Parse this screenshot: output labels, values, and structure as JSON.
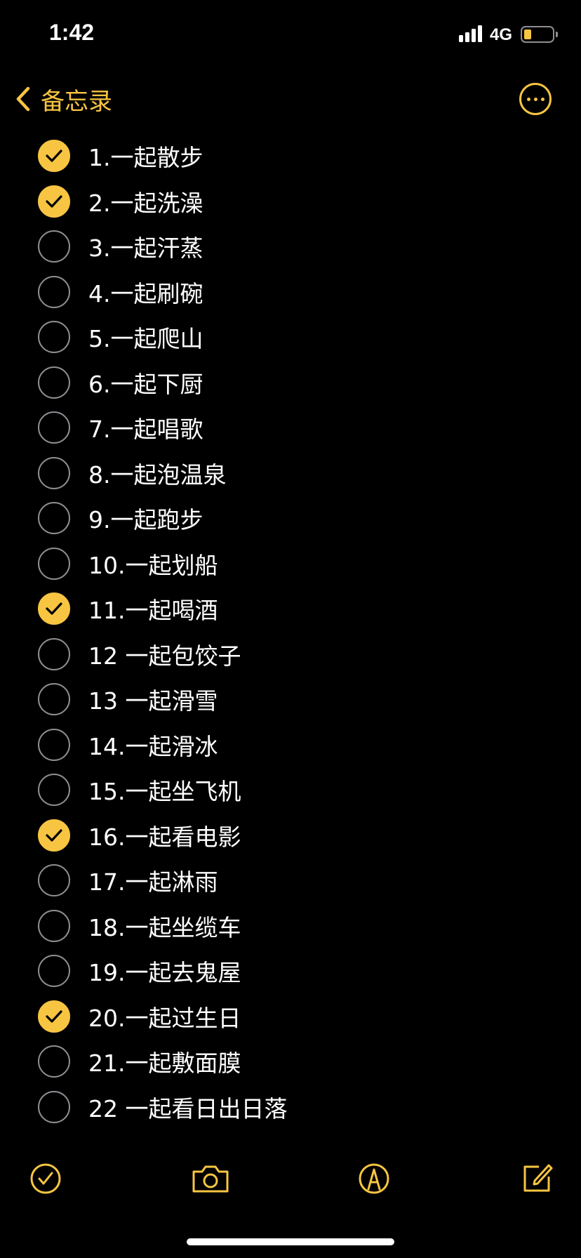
{
  "status_bar": {
    "time": "1:42",
    "network": "4G",
    "signal_icon": "signal-bars-icon",
    "battery_icon": "battery-low-icon",
    "battery_level": 0.2
  },
  "nav": {
    "back_label": "备忘录",
    "back_icon": "chevron-left-icon",
    "more_icon": "ellipsis-circle-icon"
  },
  "accent_color": "#f7c542",
  "checklist": [
    {
      "text": "1.一起散步",
      "checked": true
    },
    {
      "text": "2.一起洗澡",
      "checked": true
    },
    {
      "text": "3.一起汗蒸",
      "checked": false
    },
    {
      "text": "4.一起刷碗",
      "checked": false
    },
    {
      "text": "5.一起爬山",
      "checked": false
    },
    {
      "text": "6.一起下厨",
      "checked": false
    },
    {
      "text": "7.一起唱歌",
      "checked": false
    },
    {
      "text": "8.一起泡温泉",
      "checked": false
    },
    {
      "text": "9.一起跑步",
      "checked": false
    },
    {
      "text": "10.一起划船",
      "checked": false
    },
    {
      "text": "11.一起喝酒",
      "checked": true
    },
    {
      "text": "12 一起包饺子",
      "checked": false
    },
    {
      "text": "13 一起滑雪",
      "checked": false
    },
    {
      "text": "14.一起滑冰",
      "checked": false
    },
    {
      "text": "15.一起坐飞机",
      "checked": false
    },
    {
      "text": "16.一起看电影",
      "checked": true
    },
    {
      "text": "17.一起淋雨",
      "checked": false
    },
    {
      "text": "18.一起坐缆车",
      "checked": false
    },
    {
      "text": "19.一起去鬼屋",
      "checked": false
    },
    {
      "text": "20.一起过生日",
      "checked": true
    },
    {
      "text": "21.一起敷面膜",
      "checked": false
    },
    {
      "text": "22 一起看日出日落",
      "checked": false
    }
  ],
  "toolbar": {
    "items": [
      "checklist-icon",
      "camera-icon",
      "markup-icon",
      "compose-icon"
    ]
  }
}
